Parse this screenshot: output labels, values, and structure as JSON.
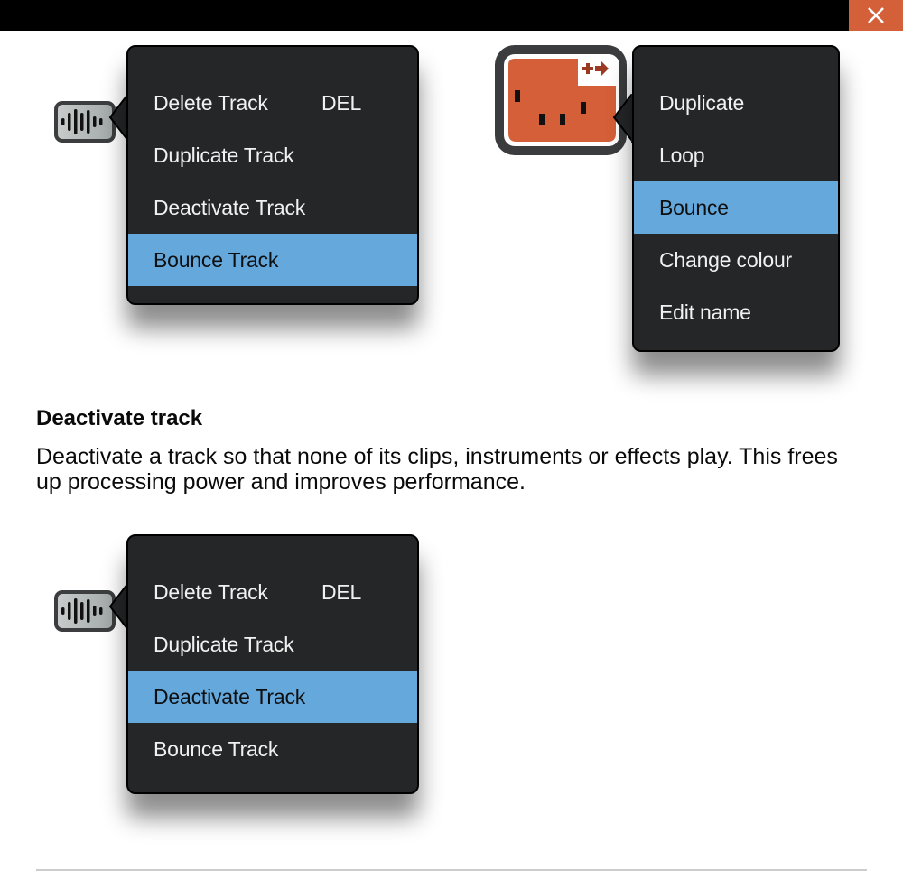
{
  "window": {
    "close_label": "Close",
    "close_color": "#d4603a"
  },
  "colors": {
    "menu_bg": "#252627",
    "highlight": "#65a8dc",
    "clip_color": "#d45f38"
  },
  "track_menu_top": {
    "icon": "track-waveform-icon",
    "items": [
      {
        "label": "Delete Track",
        "shortcut": "DEL",
        "active": false
      },
      {
        "label": "Duplicate Track",
        "active": false
      },
      {
        "label": "Deactivate Track",
        "active": false
      },
      {
        "label": "Bounce Track",
        "active": true
      }
    ]
  },
  "clip_menu": {
    "icon": "midi-clip-icon",
    "badge_icon": "add-arrow-icon",
    "items": [
      {
        "label": "Duplicate",
        "active": false
      },
      {
        "label": "Loop",
        "active": false
      },
      {
        "label": "Bounce",
        "active": true
      },
      {
        "label": "Change colour",
        "active": false
      },
      {
        "label": "Edit name",
        "active": false
      }
    ]
  },
  "section": {
    "heading": "Deactivate track",
    "description": "Deactivate a track so that none of its clips, instruments or effects play. This frees up processing power and improves performance."
  },
  "track_menu_bottom": {
    "icon": "track-waveform-icon",
    "items": [
      {
        "label": "Delete Track",
        "shortcut": "DEL",
        "active": false
      },
      {
        "label": "Duplicate Track",
        "active": false
      },
      {
        "label": "Deactivate Track",
        "active": true
      },
      {
        "label": "Bounce Track",
        "active": false
      }
    ]
  }
}
